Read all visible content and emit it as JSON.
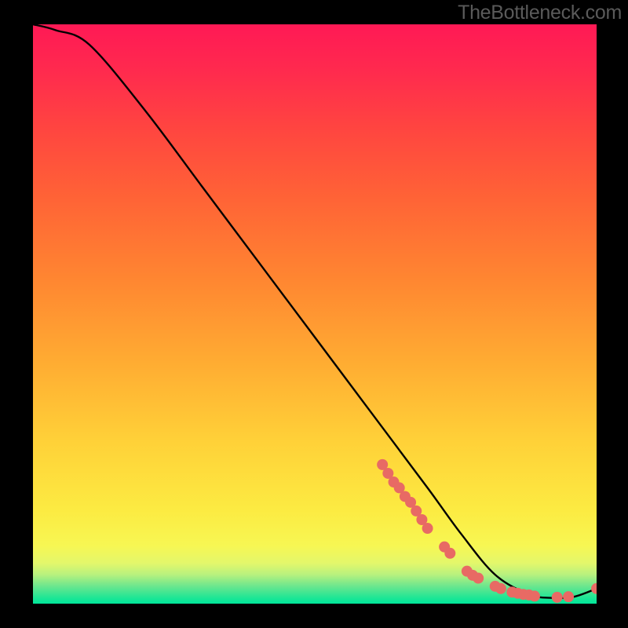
{
  "attribution": "TheBottleneck.com",
  "chart_data": {
    "type": "line",
    "title": "",
    "xlabel": "",
    "ylabel": "",
    "xlim": [
      0,
      100
    ],
    "ylim": [
      0,
      100
    ],
    "x": [
      0,
      4,
      10,
      20,
      30,
      40,
      50,
      60,
      70,
      76,
      82,
      88,
      92,
      96,
      100
    ],
    "values": [
      100,
      99,
      96.5,
      85,
      72,
      59,
      46,
      33,
      20,
      12,
      5,
      1.6,
      1.0,
      1.2,
      2.6
    ],
    "gradient_stops": [
      {
        "pos": 0,
        "color": "#ff1955"
      },
      {
        "pos": 8,
        "color": "#ff2a4e"
      },
      {
        "pos": 18,
        "color": "#ff4540"
      },
      {
        "pos": 30,
        "color": "#ff6336"
      },
      {
        "pos": 44,
        "color": "#ff8631"
      },
      {
        "pos": 58,
        "color": "#ffab32"
      },
      {
        "pos": 72,
        "color": "#ffd138"
      },
      {
        "pos": 84,
        "color": "#fceb42"
      },
      {
        "pos": 90,
        "color": "#f7f753"
      },
      {
        "pos": 93,
        "color": "#e3f76b"
      },
      {
        "pos": 95,
        "color": "#b7f17e"
      },
      {
        "pos": 97,
        "color": "#6be68e"
      },
      {
        "pos": 99,
        "color": "#1ee695"
      },
      {
        "pos": 100,
        "color": "#00e69a"
      }
    ],
    "markers": [
      {
        "x": 62,
        "y": 24
      },
      {
        "x": 63,
        "y": 22.5
      },
      {
        "x": 64,
        "y": 21
      },
      {
        "x": 65,
        "y": 20
      },
      {
        "x": 66,
        "y": 18.5
      },
      {
        "x": 67,
        "y": 17.5
      },
      {
        "x": 68,
        "y": 16
      },
      {
        "x": 69,
        "y": 14.5
      },
      {
        "x": 70,
        "y": 13
      },
      {
        "x": 73,
        "y": 9.8
      },
      {
        "x": 74,
        "y": 8.7
      },
      {
        "x": 77,
        "y": 5.6
      },
      {
        "x": 78,
        "y": 4.9
      },
      {
        "x": 79,
        "y": 4.4
      },
      {
        "x": 82,
        "y": 3.0
      },
      {
        "x": 83,
        "y": 2.6
      },
      {
        "x": 85,
        "y": 2.0
      },
      {
        "x": 86,
        "y": 1.8
      },
      {
        "x": 87,
        "y": 1.6
      },
      {
        "x": 88,
        "y": 1.5
      },
      {
        "x": 89,
        "y": 1.3
      },
      {
        "x": 93,
        "y": 1.1
      },
      {
        "x": 95,
        "y": 1.2
      },
      {
        "x": 100,
        "y": 2.6
      }
    ],
    "marker_color": "#e86a64",
    "curve_color": "#000000"
  }
}
